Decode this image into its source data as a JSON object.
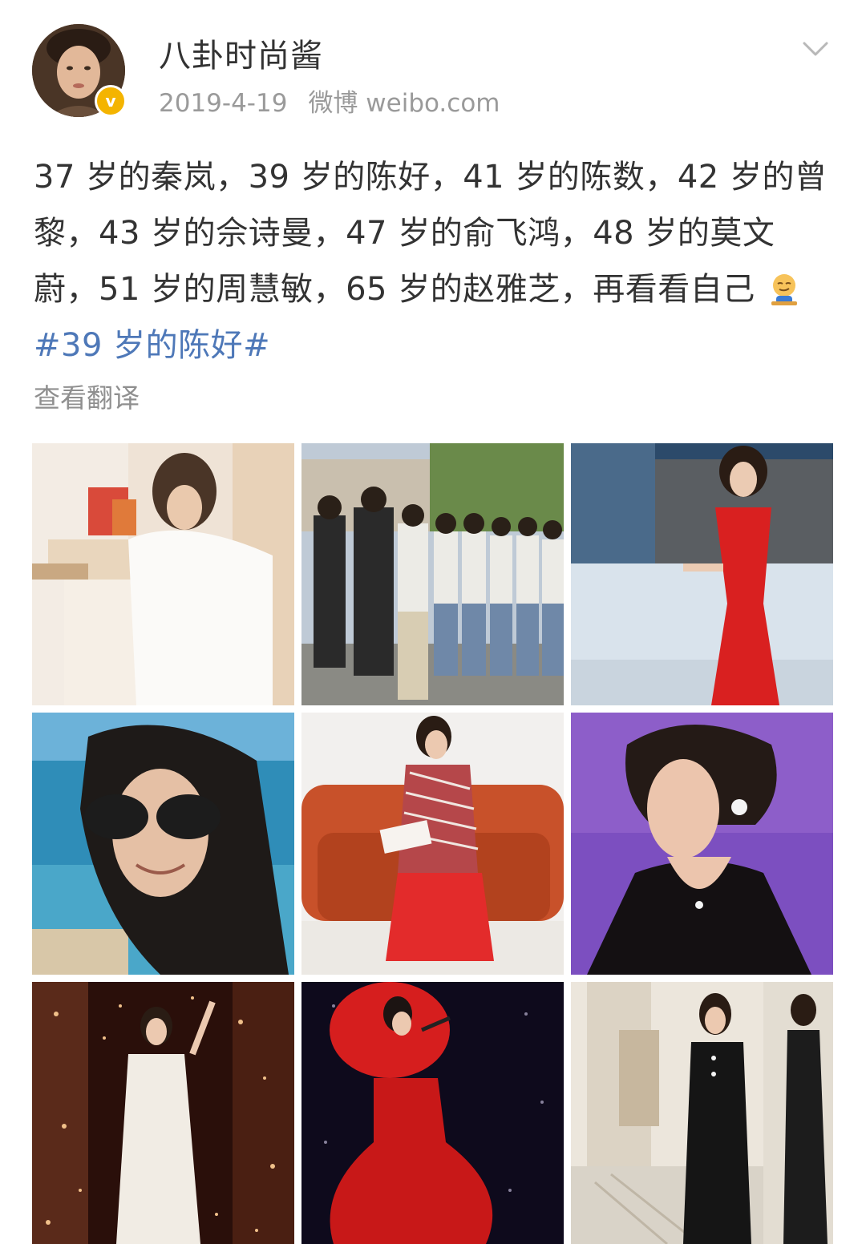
{
  "author": {
    "name": "八卦时尚酱",
    "verified_badge": "v"
  },
  "meta": {
    "date": "2019-4-19",
    "source": "微博 weibo.com"
  },
  "post": {
    "text": "37 岁的秦岚，39 岁的陈好，41 岁的陈数，42 岁的曾黎，43 岁的佘诗曼，47 岁的俞飞鸿，48 岁的莫文蔚，51 岁的周慧敏，65 岁的赵雅芝，再看看自己",
    "emoji": "smirk-emoji",
    "hashtag": "#39 岁的陈好#",
    "translate_label": "查看翻译"
  },
  "photos": [
    {
      "name": "photo-1",
      "desc_icon": "woman-white-dress-photo"
    },
    {
      "name": "photo-2",
      "desc_icon": "crowd-students-photo"
    },
    {
      "name": "photo-3",
      "desc_icon": "woman-red-gown-photo"
    },
    {
      "name": "photo-4",
      "desc_icon": "woman-sunglasses-beach-photo"
    },
    {
      "name": "photo-5",
      "desc_icon": "woman-orange-sofa-photo"
    },
    {
      "name": "photo-6",
      "desc_icon": "woman-purple-backdrop-photo"
    },
    {
      "name": "photo-7",
      "desc_icon": "woman-singing-stage-photo"
    },
    {
      "name": "photo-8",
      "desc_icon": "woman-red-dress-performing-photo"
    },
    {
      "name": "photo-9",
      "desc_icon": "woman-black-dress-hallway-photo"
    }
  ],
  "colors": {
    "link": "#4e78b8",
    "meta": "#9a9a9a",
    "badge": "#f4b400"
  }
}
